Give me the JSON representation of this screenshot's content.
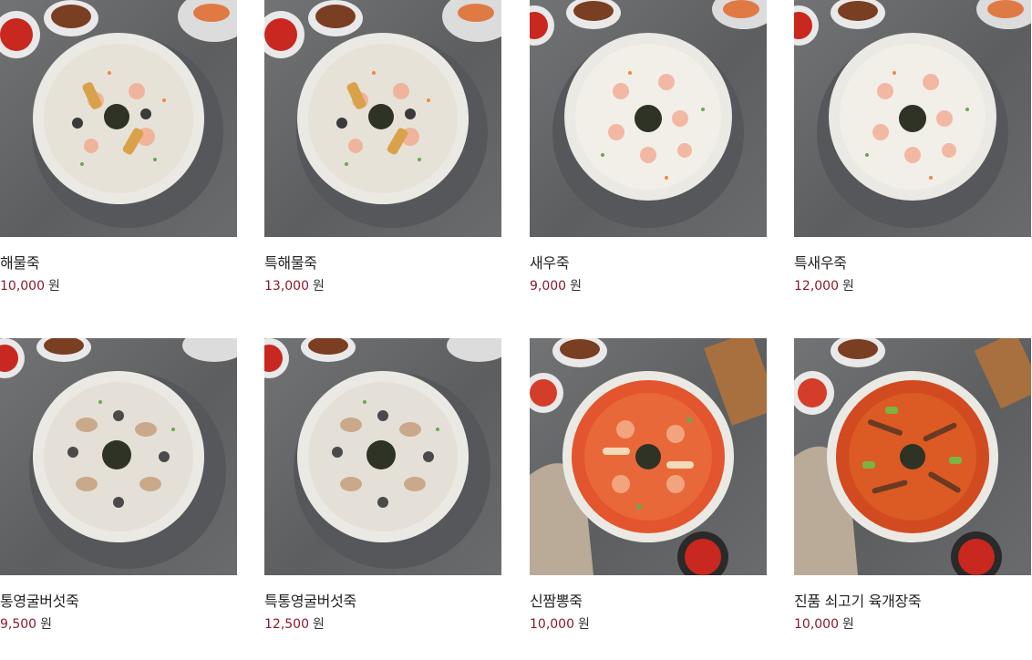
{
  "accent_color": "#8b1a2b",
  "products": [
    {
      "name": "해물죽",
      "price": "10,000",
      "currency": "원",
      "image_icon": "seafood-porridge-image"
    },
    {
      "name": "특해물죽",
      "price": "13,000",
      "currency": "원",
      "image_icon": "special-seafood-porridge-image"
    },
    {
      "name": "새우죽",
      "price": "9,000",
      "currency": "원",
      "image_icon": "shrimp-porridge-image"
    },
    {
      "name": "특새우죽",
      "price": "12,000",
      "currency": "원",
      "image_icon": "special-shrimp-porridge-image"
    },
    {
      "name": "통영굴버섯죽",
      "price": "9,500",
      "currency": "원",
      "image_icon": "oyster-mushroom-porridge-image"
    },
    {
      "name": "특통영굴버섯죽",
      "price": "12,500",
      "currency": "원",
      "image_icon": "special-oyster-mushroom-porridge-image"
    },
    {
      "name": "신짬뽕죽",
      "price": "10,000",
      "currency": "원",
      "image_icon": "spicy-jjamppong-porridge-image"
    },
    {
      "name": "진품 쇠고기 육개장죽",
      "price": "10,000",
      "currency": "원",
      "image_icon": "beef-yukgaejang-porridge-image"
    }
  ]
}
